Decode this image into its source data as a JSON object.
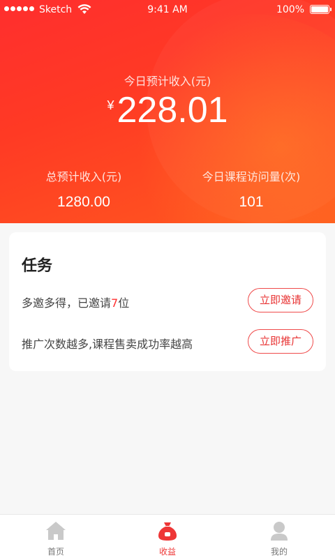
{
  "status_bar": {
    "carrier": "Sketch",
    "time": "9:41 AM",
    "battery": "100%"
  },
  "hero": {
    "today_label": "今日预计收入(元)",
    "currency_symbol": "¥",
    "today_amount": "228.01",
    "stats": [
      {
        "label": "总预计收入(元)",
        "value": "1280.00"
      },
      {
        "label": "今日课程访问量(次)",
        "value": "101"
      }
    ]
  },
  "tasks": {
    "title": "任务",
    "items": [
      {
        "text_before": "多邀多得，已邀请",
        "count": "7",
        "text_after": "位",
        "button": "立即邀请"
      },
      {
        "text": "推广次数越多,课程售卖成功率越高",
        "button": "立即推广"
      }
    ]
  },
  "tab_bar": {
    "tabs": [
      {
        "label": "首页",
        "icon": "home-icon",
        "active": false
      },
      {
        "label": "收益",
        "icon": "money-bag-icon",
        "active": true
      },
      {
        "label": "我的",
        "icon": "user-icon",
        "active": false
      }
    ]
  },
  "colors": {
    "accent": "#ee3636",
    "hero_start": "#ff2e2e",
    "hero_end": "#ff5a1f"
  }
}
